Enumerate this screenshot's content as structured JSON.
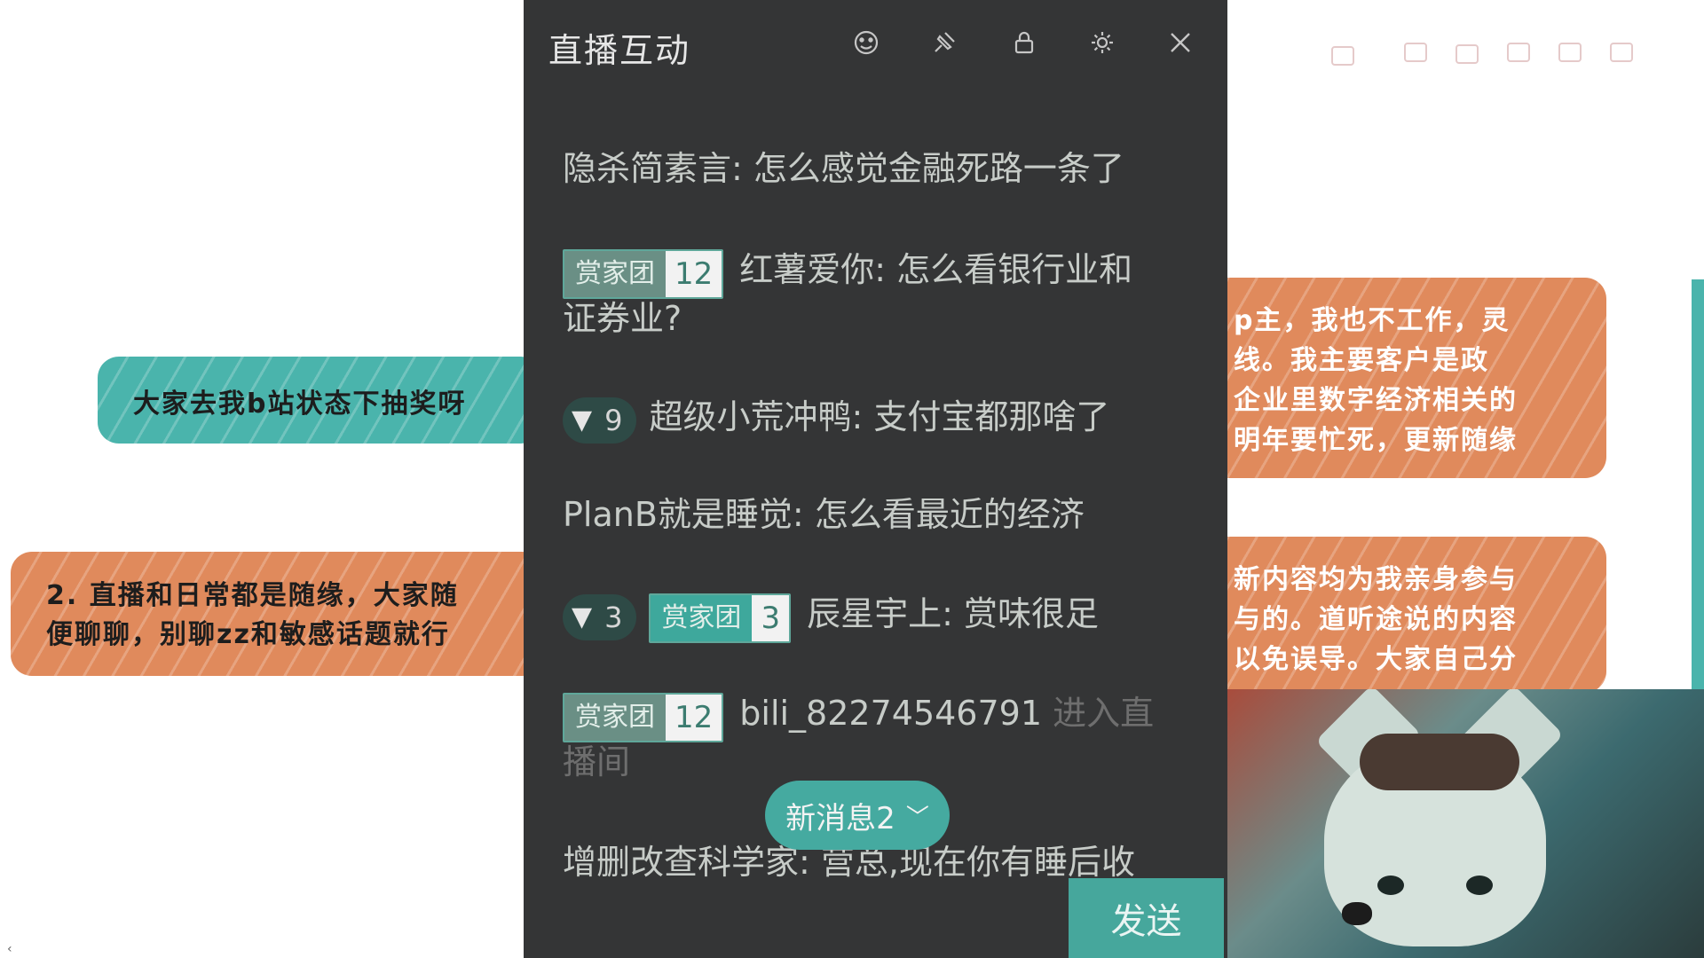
{
  "background_notes": {
    "left_note_1": "大家去我b站状态下抽奖呀",
    "left_note_2_line1": "2. 直播和日常都是随缘，大家随",
    "left_note_2_line2": "便聊聊，别聊zz和敏感话题就行",
    "right_note_1_lines": [
      "p主，我也不工作，灵",
      "线。我主要客户是政",
      "企业里数字经济相关的",
      "明年要忙死，更新随缘"
    ],
    "right_note_2_lines": [
      "新内容均为我亲身参与",
      "与的。道听途说的内容",
      "以免误导。大家自己分"
    ]
  },
  "chat": {
    "title": "直播互动",
    "header_icons": [
      "emoji-face-icon",
      "pin-icon",
      "lock-icon",
      "settings-icon",
      "close-icon"
    ],
    "new_messages_label": "新消息2",
    "send_label": "发送",
    "messages": [
      {
        "user": "隐杀简素言",
        "text": "怎么感觉金融死路一条了"
      },
      {
        "medal_name": "赏家团",
        "medal_level": "12",
        "user": "红薯爱你",
        "text_line1": "怎么看银行业和",
        "text_line2": "证券业?"
      },
      {
        "guard_level": "9",
        "user": "超级小荒冲鸭",
        "text": "支付宝都那啥了"
      },
      {
        "user": "PlanB就是睡觉",
        "text": "怎么看最近的经济"
      },
      {
        "guard_level": "3",
        "medal_name": "赏家团",
        "medal_level": "3",
        "user": "辰星宇上",
        "text": "赏味很足"
      },
      {
        "medal_name": "赏家团",
        "medal_level": "12",
        "user": "bili_82274546791",
        "system_line1": "进入直",
        "system_line2": "播间"
      },
      {
        "user": "增删改查科学家",
        "text": "营总,现在你有睡后收"
      }
    ]
  },
  "colors": {
    "panel_bg": "#343536",
    "accent_teal": "#45aaa0",
    "note_orange": "#e08a5c",
    "note_teal": "#4ab4ac"
  }
}
